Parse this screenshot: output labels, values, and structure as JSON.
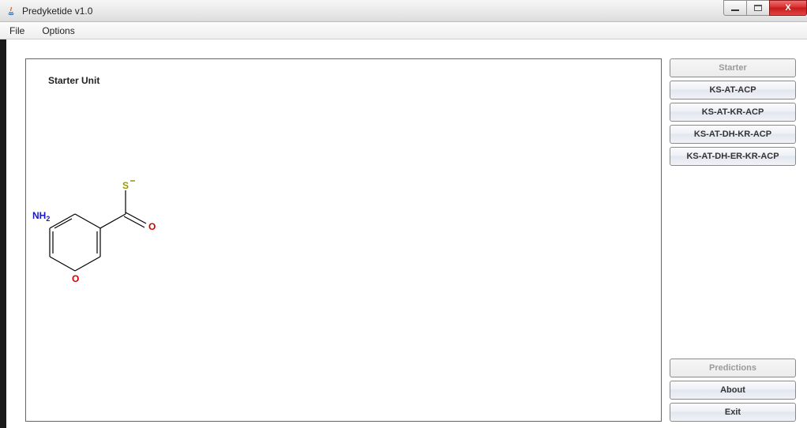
{
  "window": {
    "title": "Predyketide v1.0"
  },
  "menubar": {
    "file": "File",
    "options": "Options"
  },
  "canvas": {
    "title": "Starter Unit"
  },
  "side": {
    "starter": "Starter",
    "ks_at_acp": "KS-AT-ACP",
    "ks_at_kr_acp": "KS-AT-KR-ACP",
    "ks_at_dh_kr_acp": "KS-AT-DH-KR-ACP",
    "ks_at_dh_er_kr_acp": "KS-AT-DH-ER-KR-ACP",
    "predictions": "Predictions",
    "about": "About",
    "exit": "Exit"
  },
  "molecule": {
    "atoms": {
      "nh2": "NH",
      "nh2_sub": "2",
      "s": "S",
      "o_carbonyl": "O",
      "o_hydroxyl": "O"
    }
  }
}
